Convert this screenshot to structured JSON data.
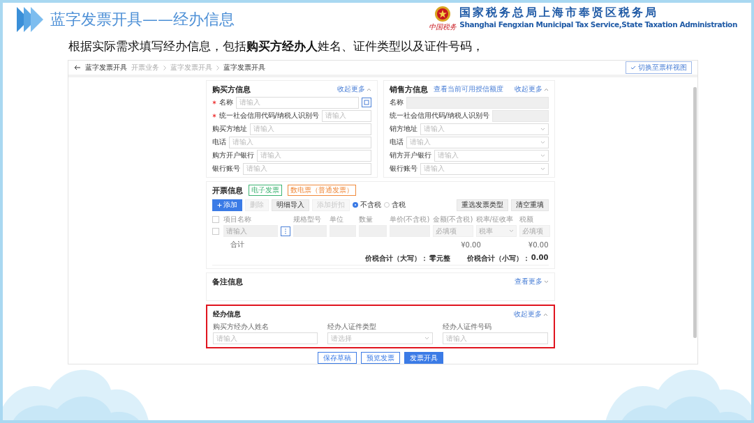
{
  "slide": {
    "title": "蓝字发票开具——经办信息",
    "org_cn": "国家税务总局上海市奉贤区税务局",
    "org_en": "Shanghai Fengxian Municipal Tax Service,State Taxation Administration",
    "logo_text": "中国税务",
    "subtitle": "根据实际需求填写经办信息，包括**购买方经办人**姓名、证件类型以及证件号码，"
  },
  "page": {
    "back_title": "蓝字发票开具",
    "breadcrumbs": [
      "开票业务",
      "蓝字发票开具",
      "蓝字发票开具"
    ],
    "view_button": "切换至票样视图"
  },
  "buyer": {
    "title": "购买方信息",
    "toggle": "收起更多",
    "expanded": true,
    "fields": [
      {
        "label": "名称",
        "required": true,
        "kind": "input-picker",
        "placeholder": "请输入"
      },
      {
        "label": "统一社会信用代码/纳税人识别号",
        "required": true,
        "kind": "input",
        "placeholder": "请输入"
      },
      {
        "label": "购买方地址",
        "required": false,
        "kind": "input",
        "placeholder": "请输入"
      },
      {
        "label": "电话",
        "required": false,
        "kind": "input",
        "placeholder": "请输入"
      },
      {
        "label": "购方开户银行",
        "required": false,
        "kind": "input",
        "placeholder": "请输入"
      },
      {
        "label": "银行账号",
        "required": false,
        "kind": "input",
        "placeholder": "请输入"
      }
    ]
  },
  "seller": {
    "title": "销售方信息",
    "link": "查看当前可用授信额度",
    "toggle": "收起更多",
    "expanded": true,
    "fields": [
      {
        "label": "名称",
        "required": false,
        "kind": "readonly"
      },
      {
        "label": "统一社会信用代码/纳税人识别号",
        "required": false,
        "kind": "readonly"
      },
      {
        "label": "销方地址",
        "required": false,
        "kind": "select",
        "placeholder": "请输入"
      },
      {
        "label": "电话",
        "required": false,
        "kind": "select",
        "placeholder": "请输入"
      },
      {
        "label": "销方开户银行",
        "required": false,
        "kind": "select",
        "placeholder": "请输入"
      },
      {
        "label": "银行账号",
        "required": false,
        "kind": "select",
        "placeholder": "请输入"
      }
    ]
  },
  "invoice": {
    "title": "开票信息",
    "tags": [
      {
        "text": "电子发票",
        "color": "#3cb371"
      },
      {
        "text": "数电票（普通发票）",
        "color": "#f08a3c"
      }
    ],
    "actions": [
      {
        "label": "添加",
        "kind": "primary",
        "disabled": false
      },
      {
        "label": "删除",
        "kind": "default",
        "disabled": true
      },
      {
        "label": "明细导入",
        "kind": "default",
        "disabled": false
      },
      {
        "label": "添加折扣",
        "kind": "default",
        "disabled": true
      }
    ],
    "radios": [
      {
        "label": "不含税",
        "selected": true
      },
      {
        "label": "含税",
        "selected": false
      }
    ],
    "actions_right": [
      {
        "label": "重选发票类型",
        "disabled": false
      },
      {
        "label": "清空重填",
        "disabled": false
      }
    ],
    "select_all_checked": false,
    "columns": [
      "项目名称",
      "规格型号",
      "单位",
      "数量",
      "单价(不含税)",
      "金额(不含税)",
      "税率/征收率",
      "税额"
    ],
    "row": {
      "checked": false,
      "cells": [
        {
          "kind": "input",
          "text": "请输入"
        },
        {
          "kind": "input"
        },
        {
          "kind": "input"
        },
        {
          "kind": "input"
        },
        {
          "kind": "input"
        },
        {
          "kind": "readonly",
          "text": "必填项"
        },
        {
          "kind": "select",
          "text": "税率"
        },
        {
          "kind": "readonly",
          "text": "必填项"
        }
      ]
    },
    "total_label": "合计",
    "total_amount": "¥0.00",
    "total_tax": "¥0.00",
    "upper_label": "价税合计（大写）：",
    "upper_value": "零元整",
    "lower_label": "价税合计（小写）：",
    "lower_value": "0.00"
  },
  "remarks": {
    "title": "备注信息",
    "toggle": "查看更多",
    "expanded": false
  },
  "agent": {
    "title": "经办信息",
    "toggle": "收起更多",
    "expanded": true,
    "highlighted": true,
    "fields": [
      {
        "label": "购买方经办人姓名",
        "kind": "input",
        "placeholder": "请输入"
      },
      {
        "label": "经办人证件类型",
        "kind": "select",
        "placeholder": "请选择"
      },
      {
        "label": "经办人证件号码",
        "kind": "input",
        "placeholder": "请输入"
      }
    ]
  },
  "footer_buttons": [
    {
      "label": "保存草稿",
      "kind": "default"
    },
    {
      "label": "预览发票",
      "kind": "default"
    },
    {
      "label": "发票开具",
      "kind": "primary"
    }
  ]
}
